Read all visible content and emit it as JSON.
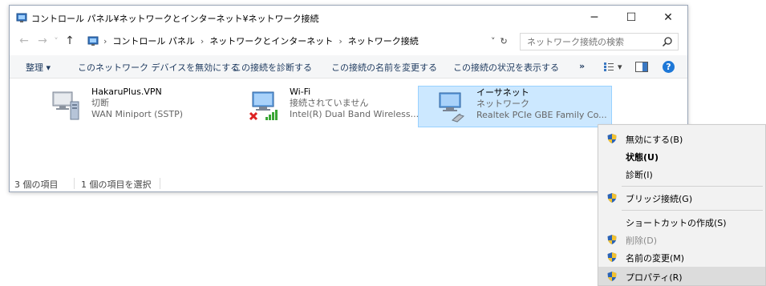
{
  "window": {
    "title": "コントロール パネル¥ネットワークとインターネット¥ネットワーク接続",
    "minimize_glyph": "─",
    "maximize_glyph": "☐",
    "close_glyph": "✕"
  },
  "address": {
    "back_glyph": "←",
    "forward_glyph": "→",
    "recent_glyph": "˅",
    "up_glyph": "↑",
    "crumbs": [
      "コントロール パネル",
      "ネットワークとインターネット",
      "ネットワーク接続"
    ],
    "separator": "›",
    "dropdown_glyph": "˅",
    "refresh_glyph": "↻",
    "search_placeholder": "ネットワーク接続の検索"
  },
  "commands": {
    "organize": "整理 ▾",
    "disable": "このネットワーク デバイスを無効にする",
    "diagnose": "この接続を診断する",
    "rename": "この接続の名前を変更する",
    "status": "この接続の状況を表示する",
    "more": "»",
    "view_dropdown": "▾",
    "help": "?"
  },
  "connections": [
    {
      "name": "HakaruPlus.VPN",
      "status": "切断",
      "device": "WAN Miniport (SSTP)",
      "icon": "vpn-icon",
      "selected": false
    },
    {
      "name": "Wi-Fi",
      "status": "接続されていません",
      "device": "Intel(R) Dual Band Wireless...",
      "icon": "wifi-adapter-icon",
      "selected": false
    },
    {
      "name": "イーサネット",
      "status": "ネットワーク",
      "device": "Realtek PCIe GBE Family Co...",
      "icon": "ethernet-adapter-icon",
      "selected": true
    }
  ],
  "statusbar": {
    "count": "3 個の項目",
    "selected": "1 個の項目を選択"
  },
  "context_menu": {
    "items": [
      {
        "label": "無効にする(B)",
        "shield": true,
        "bold": false,
        "disabled": false,
        "highlight": false
      },
      {
        "label": "状態(U)",
        "shield": false,
        "bold": true,
        "disabled": false,
        "highlight": false
      },
      {
        "label": "診断(I)",
        "shield": false,
        "bold": false,
        "disabled": false,
        "highlight": false
      },
      {
        "label": "ブリッジ接続(G)",
        "shield": true,
        "bold": false,
        "disabled": false,
        "highlight": false
      },
      {
        "label": "ショートカットの作成(S)",
        "shield": false,
        "bold": false,
        "disabled": false,
        "highlight": false
      },
      {
        "label": "削除(D)",
        "shield": true,
        "bold": false,
        "disabled": true,
        "highlight": false
      },
      {
        "label": "名前の変更(M)",
        "shield": true,
        "bold": false,
        "disabled": false,
        "highlight": false
      },
      {
        "label": "プロパティ(R)",
        "shield": true,
        "bold": false,
        "disabled": false,
        "highlight": true
      }
    ]
  },
  "colors": {
    "selection_bg": "#cce8ff",
    "selection_border": "#99d1ff",
    "help_blue": "#1e78d7",
    "shield_blue": "#2b63b5",
    "shield_yellow": "#f2c230"
  }
}
